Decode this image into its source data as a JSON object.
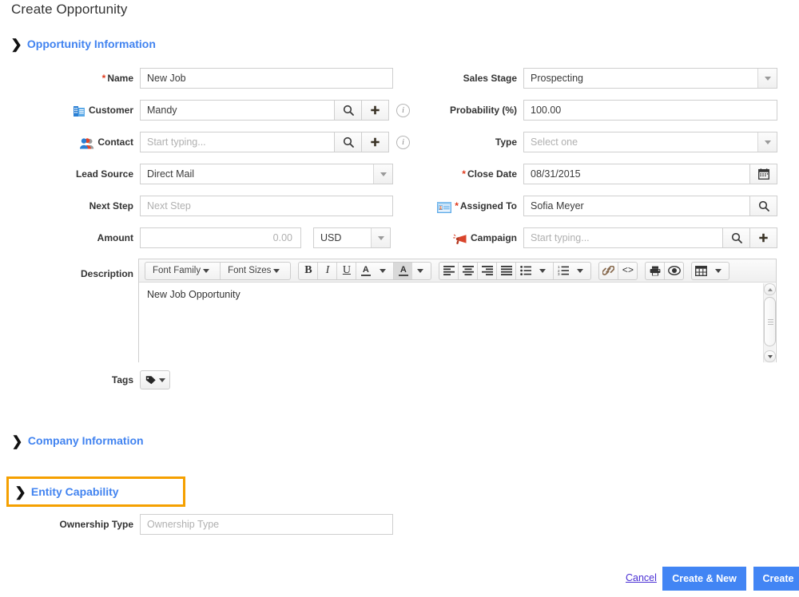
{
  "page": {
    "title": "Create Opportunity"
  },
  "sections": {
    "opportunity": {
      "label": "Opportunity Information",
      "caret": "chevron-down",
      "expanded": true
    },
    "company": {
      "label": "Company Information",
      "caret": "chevron-right",
      "expanded": false
    },
    "entity": {
      "label": "Entity Capability",
      "caret": "chevron-down",
      "expanded": true,
      "highlight_color": "#f5a000"
    }
  },
  "left_fields": {
    "name": {
      "label": "Name",
      "required": true,
      "value": "New Job",
      "placeholder": ""
    },
    "customer": {
      "label": "Customer",
      "required": false,
      "value": "Mandy",
      "placeholder": "",
      "icon": "building-icon",
      "buttons": [
        "search-icon",
        "plus-icon"
      ],
      "info": "i"
    },
    "contact": {
      "label": "Contact",
      "required": false,
      "value": "",
      "placeholder": "Start typing...",
      "icon": "people-icon",
      "buttons": [
        "search-icon",
        "plus-icon"
      ],
      "info": "i"
    },
    "lead_source": {
      "label": "Lead Source",
      "required": false,
      "value": "Direct Mail",
      "placeholder": ""
    },
    "next_step": {
      "label": "Next Step",
      "required": false,
      "value": "",
      "placeholder": "Next Step"
    },
    "amount": {
      "label": "Amount",
      "required": false,
      "value": "",
      "placeholder": "0.00",
      "currency": "USD"
    },
    "description": {
      "label": "Description",
      "value": "New Job Opportunity"
    },
    "tags": {
      "label": "Tags",
      "icon": "tag-icon"
    }
  },
  "right_fields": {
    "sales_stage": {
      "label": "Sales Stage",
      "required": false,
      "value": "Prospecting",
      "placeholder": ""
    },
    "probability": {
      "label": "Probability (%)",
      "required": false,
      "value": "100.00",
      "placeholder": ""
    },
    "type": {
      "label": "Type",
      "required": false,
      "value": "",
      "placeholder": "Select one"
    },
    "close_date": {
      "label": "Close Date",
      "required": true,
      "value": "08/31/2015",
      "placeholder": "",
      "buttons": [
        "calendar-icon"
      ]
    },
    "assigned_to": {
      "label": "Assigned To",
      "required": true,
      "value": "Sofia Meyer",
      "placeholder": "",
      "icon": "id-card-icon",
      "buttons": [
        "search-icon"
      ]
    },
    "campaign": {
      "label": "Campaign",
      "required": false,
      "value": "",
      "placeholder": "Start typing...",
      "icon": "megaphone-icon",
      "buttons": [
        "search-icon",
        "plus-icon"
      ]
    }
  },
  "entity_fields": {
    "ownership_type": {
      "label": "Ownership Type",
      "value": "",
      "placeholder": "Ownership Type"
    }
  },
  "editor_toolbar": {
    "font_family": "Font Family",
    "font_sizes": "Font Sizes",
    "bold": "B",
    "italic": "I",
    "underline": "U",
    "text_color": "A",
    "background_color": "A",
    "align_left": "align-left-icon",
    "align_center": "align-center-icon",
    "align_right": "align-right-icon",
    "align_justify": "align-justify-icon",
    "bullet_list": "bullet-list-icon",
    "numbered_list": "numbered-list-icon",
    "link": "link-icon",
    "source_code": "source-code-icon",
    "print": "print-icon",
    "preview": "preview-icon",
    "table": "table-icon"
  },
  "footer": {
    "cancel": "Cancel",
    "create_and_new": "Create & New",
    "create": "Create",
    "primary_color": "#4285f4",
    "link_color": "#4a2fd4"
  },
  "colors": {
    "section_link": "#4183f0",
    "required_mark": "#e03a1c",
    "highlight": "#f5a000"
  }
}
